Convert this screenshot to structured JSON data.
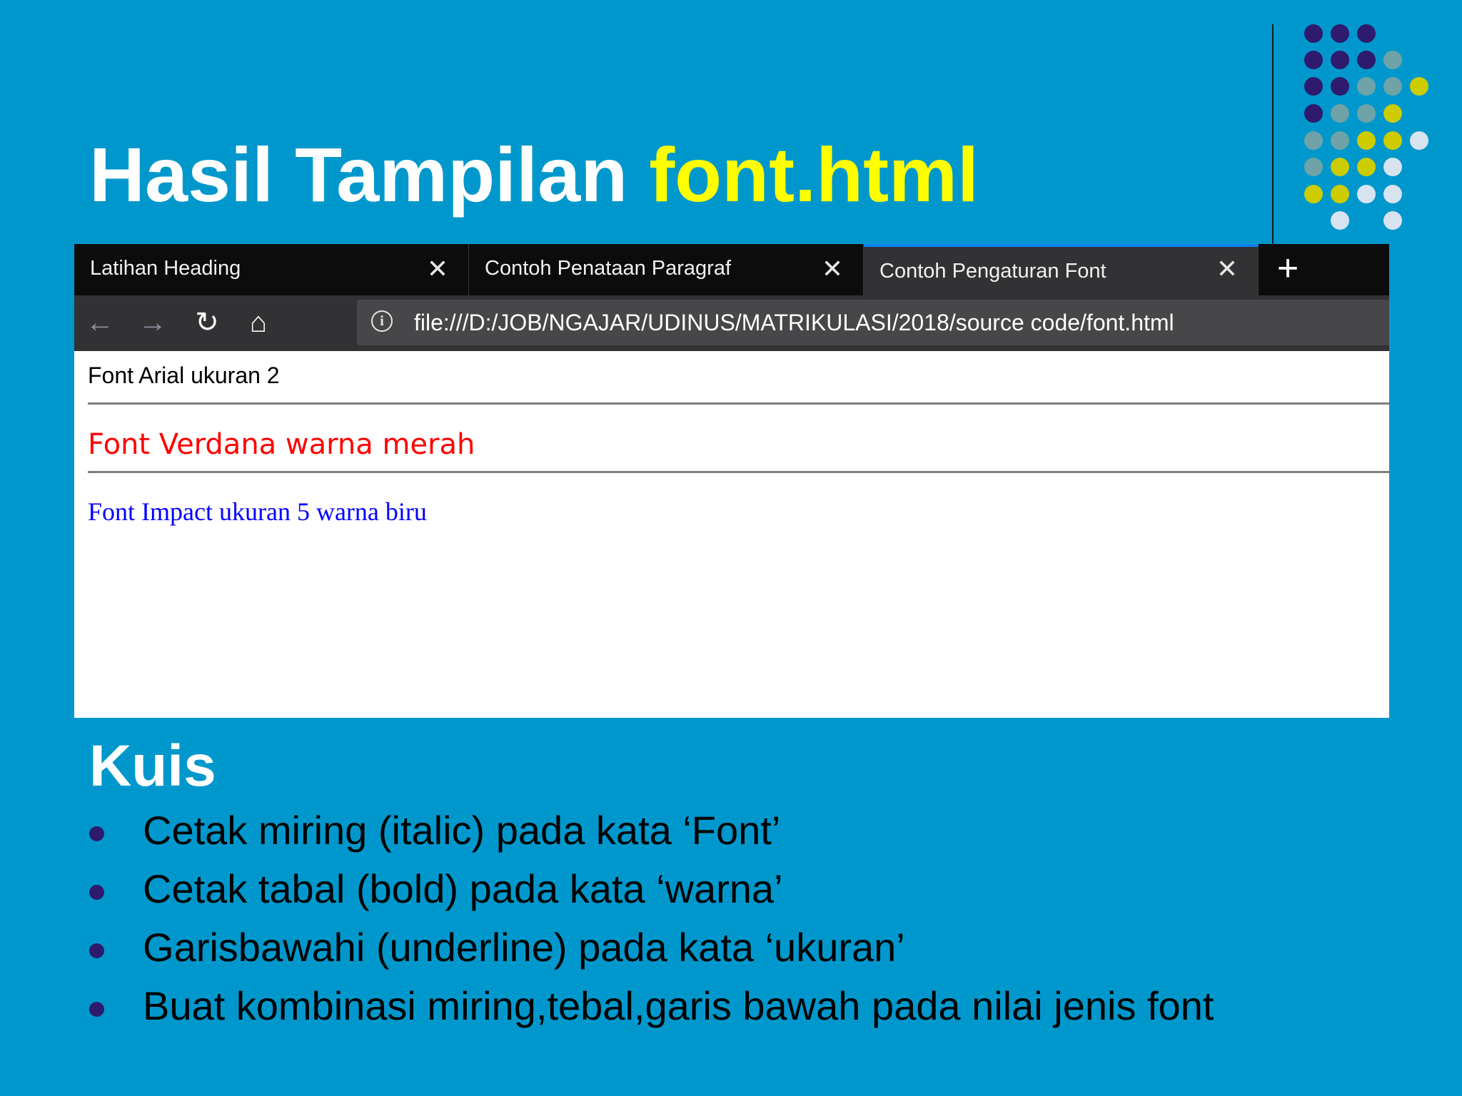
{
  "slide": {
    "title_prefix": "Hasil Tampilan ",
    "title_highlight": "font.html",
    "colors": {
      "background": "#0098cc",
      "highlight": "#ffff00",
      "dot_purple": "#2e1a6e",
      "dot_gray": "#6fa3a8",
      "dot_yellow": "#cccc00",
      "dot_white": "#d8e3f0"
    }
  },
  "browser": {
    "tabs": [
      {
        "label": "Latihan Heading",
        "active": false
      },
      {
        "label": "Contoh Penataan Paragraf",
        "active": false
      },
      {
        "label": "Contoh Pengaturan Font",
        "active": true
      }
    ],
    "close_glyph": "✕",
    "new_tab_glyph": "+",
    "nav": {
      "back": "←",
      "forward": "→",
      "reload": "↻",
      "home": "⌂",
      "icons": [
        "back-arrow-icon",
        "forward-arrow-icon",
        "reload-icon",
        "home-icon"
      ]
    },
    "url": "file:///D:/JOB/NGAJAR/UDINUS/MATRIKULASI/2018/source code/font.html",
    "info_glyph": "i",
    "content": {
      "line1": "Font Arial ukuran 2",
      "line2": "Font Verdana warna merah",
      "line3": "Font Impact ukuran 5 warna biru"
    }
  },
  "kuis": {
    "title": "Kuis",
    "items": [
      "Cetak miring (italic) pada kata ‘Font’",
      "Cetak tabal (bold) pada kata ‘warna’",
      "Garisbawahi (underline) pada kata ‘ukuran’",
      "Buat kombinasi miring,tebal,garis bawah pada nilai jenis font"
    ]
  }
}
